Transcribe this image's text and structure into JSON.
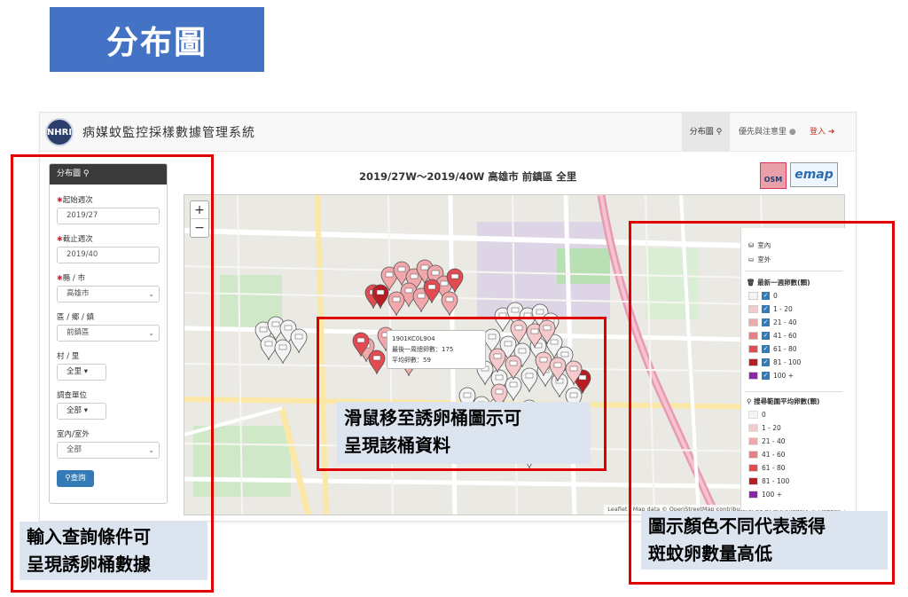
{
  "slide": {
    "title": "分布圖",
    "callout_left": [
      "輸入查詢條件可",
      "呈現誘卵桶數據"
    ],
    "callout_center": [
      "滑鼠移至誘卵桶圖示可",
      "呈現該桶資料"
    ],
    "callout_right": [
      "圖示顏色不同代表誘得",
      "斑蚊卵數量高低"
    ]
  },
  "navbar": {
    "logo_text": "NHRI",
    "brand": "病媒蚊監控採樣數據管理系統",
    "distribution": "分布圖",
    "priority": "優先與注意里",
    "login": "登入"
  },
  "panel": {
    "header": "分布圖",
    "start_week_label": "起始週次",
    "start_week_value": "2019/27",
    "end_week_label": "截止週次",
    "end_week_value": "2019/40",
    "county_label": "縣 / 市",
    "county_value": "高雄市",
    "district_label": "區 / 鄉 / 鎮",
    "district_value": "前鎮區",
    "village_label": "村 / 里",
    "village_value": "全里",
    "unit_label": "調查單位",
    "unit_value": "全部",
    "indoor_label": "室內/室外",
    "indoor_value": "全部",
    "query_button": "查詢"
  },
  "map": {
    "title": "2019/27W～2019/40W 高雄市 前鎮區 全里",
    "osm_label": "OSM",
    "emap_label": "emap",
    "zoom_in": "+",
    "zoom_out": "−",
    "attribution": "Leaflet | Map data © OpenStreetMap contributors, CC-BY-SA, Imagery © Mapbox",
    "tooltip": {
      "id": "1901KC0L904",
      "last_week": "最後一周總卵數：175",
      "average": "平均卵數：59"
    }
  },
  "legend": {
    "indoor": "室內",
    "outdoor": "室外",
    "latest_week_title": "最新一週卵數(顆)",
    "avg_title": "搜尋範圍平均卵數(顆)",
    "ranges": [
      {
        "label": "0",
        "color": "#f4f4f4"
      },
      {
        "label": "1 - 20",
        "color": "#f6c9cc"
      },
      {
        "label": "21 - 40",
        "color": "#f2a7ab"
      },
      {
        "label": "41 - 60",
        "color": "#ec7d83"
      },
      {
        "label": "61 - 80",
        "color": "#e24b52"
      },
      {
        "label": "81 - 100",
        "color": "#b81d24"
      },
      {
        "label": "100 +",
        "color": "#8e24aa"
      }
    ]
  }
}
